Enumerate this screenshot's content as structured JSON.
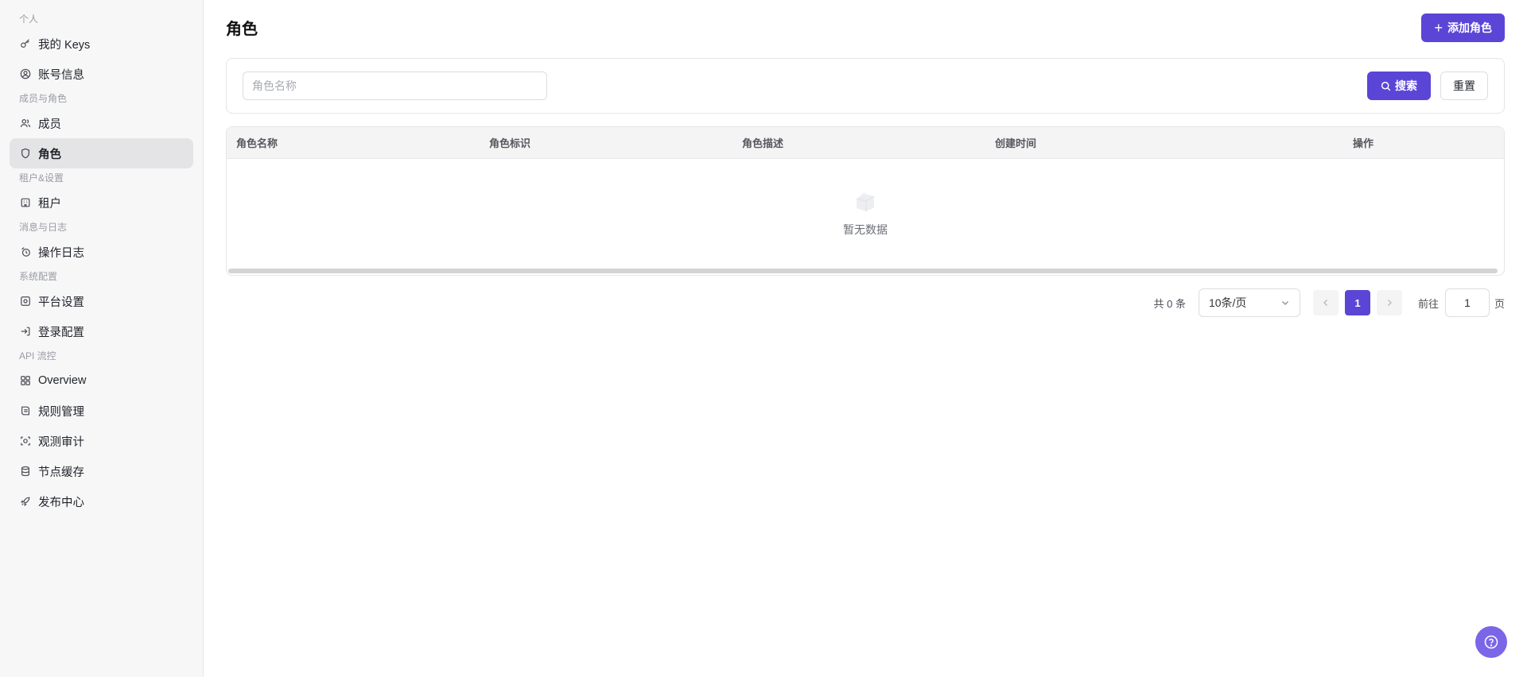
{
  "sidebar": {
    "groups": [
      {
        "label": "个人",
        "items": [
          {
            "label": "我的 Keys",
            "icon": "key-icon"
          },
          {
            "label": "账号信息",
            "icon": "user-circle-icon"
          }
        ]
      },
      {
        "label": "成员与角色",
        "items": [
          {
            "label": "成员",
            "icon": "users-icon"
          },
          {
            "label": "角色",
            "icon": "shield-icon",
            "active": true
          }
        ]
      },
      {
        "label": "租户&设置",
        "items": [
          {
            "label": "租户",
            "icon": "building-icon"
          }
        ]
      },
      {
        "label": "消息与日志",
        "items": [
          {
            "label": "操作日志",
            "icon": "log-icon"
          }
        ]
      },
      {
        "label": "系统配置",
        "items": [
          {
            "label": "平台设置",
            "icon": "settings-icon"
          },
          {
            "label": "登录配置",
            "icon": "login-icon"
          }
        ]
      },
      {
        "label": "API 流控",
        "items": [
          {
            "label": "Overview",
            "icon": "grid-icon"
          },
          {
            "label": "规则管理",
            "icon": "rules-icon"
          },
          {
            "label": "观测审计",
            "icon": "scan-icon"
          },
          {
            "label": "节点缓存",
            "icon": "database-icon"
          },
          {
            "label": "发布中心",
            "icon": "rocket-icon"
          }
        ]
      }
    ]
  },
  "header": {
    "title": "角色",
    "add_button": "添加角色"
  },
  "search": {
    "placeholder": "角色名称",
    "value": "",
    "search_button": "搜索",
    "reset_button": "重置"
  },
  "table": {
    "columns": [
      "角色名称",
      "角色标识",
      "角色描述",
      "创建时间",
      "操作"
    ],
    "rows": [],
    "empty_text": "暂无数据"
  },
  "pagination": {
    "total_text": "共 0 条",
    "page_size": "10条/页",
    "current_page": "1",
    "goto_label": "前往",
    "goto_value": "1",
    "page_unit": "页"
  },
  "colors": {
    "accent": "#5b45d6",
    "fab": "#7b66e8"
  }
}
